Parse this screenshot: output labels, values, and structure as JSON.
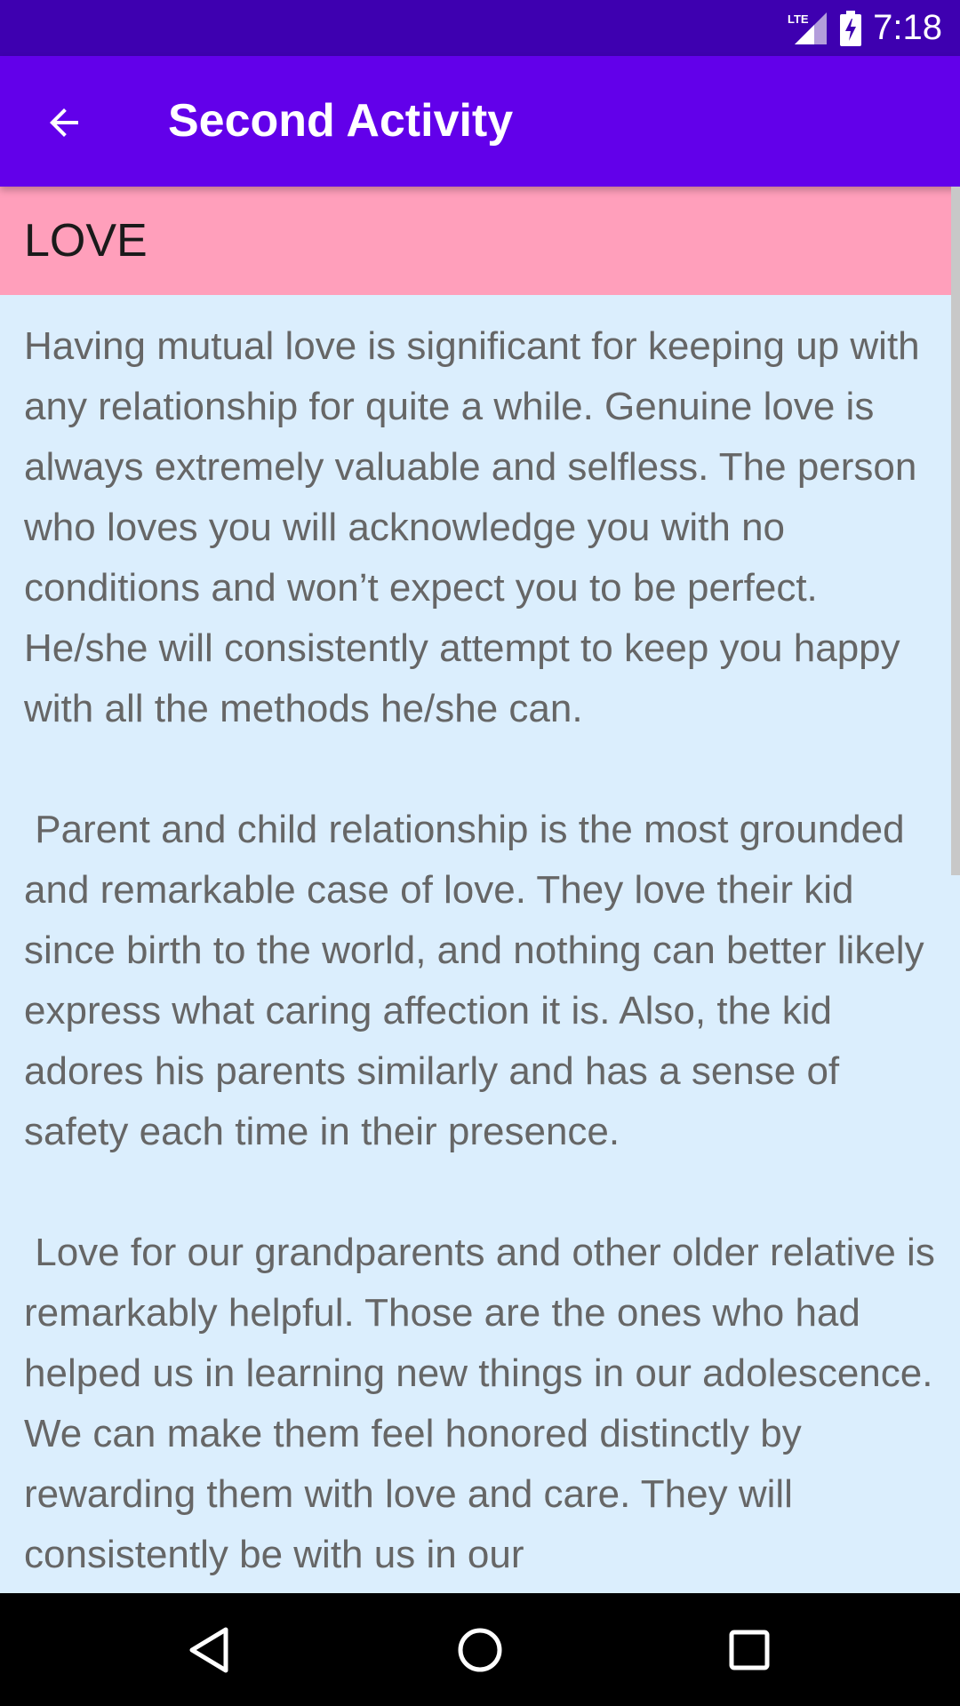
{
  "status_bar": {
    "time": "7:18",
    "network_label": "LTE",
    "icons": [
      "signal-icon",
      "battery-charging-icon"
    ]
  },
  "app_bar": {
    "title": "Second Activity",
    "back_icon": "arrow-back-icon"
  },
  "section": {
    "title": "LOVE"
  },
  "content": {
    "body": "Having mutual love is significant for keeping up with any relationship for quite a while. Genuine love is always extremely valuable and selfless. The person who loves you will acknowledge you with no conditions and won’t expect you to be perfect. He/she will consistently attempt to keep you happy with all the methods he/she can.\n\n Parent and child relationship is the most grounded and remarkable case of love. They love their kid since birth to the world, and nothing can better likely express what caring affection it is. Also, the kid adores his parents similarly and has a sense of safety each time in their presence.\n\n Love for our grandparents and other older relative is remarkably helpful. Those are the ones who had helped us in learning new things in our adolescence. We can make them feel honored distinctly by rewarding them with love and care. They will consistently be with us in our"
  },
  "nav_bar": {
    "icons": [
      "back-triangle-icon",
      "home-circle-icon",
      "recents-square-icon"
    ]
  },
  "colors": {
    "status_bar": "#3e00b0",
    "app_bar": "#6200ea",
    "section_header": "#ff9fbb",
    "content_background": "#dbeefd",
    "body_text": "#666666"
  }
}
